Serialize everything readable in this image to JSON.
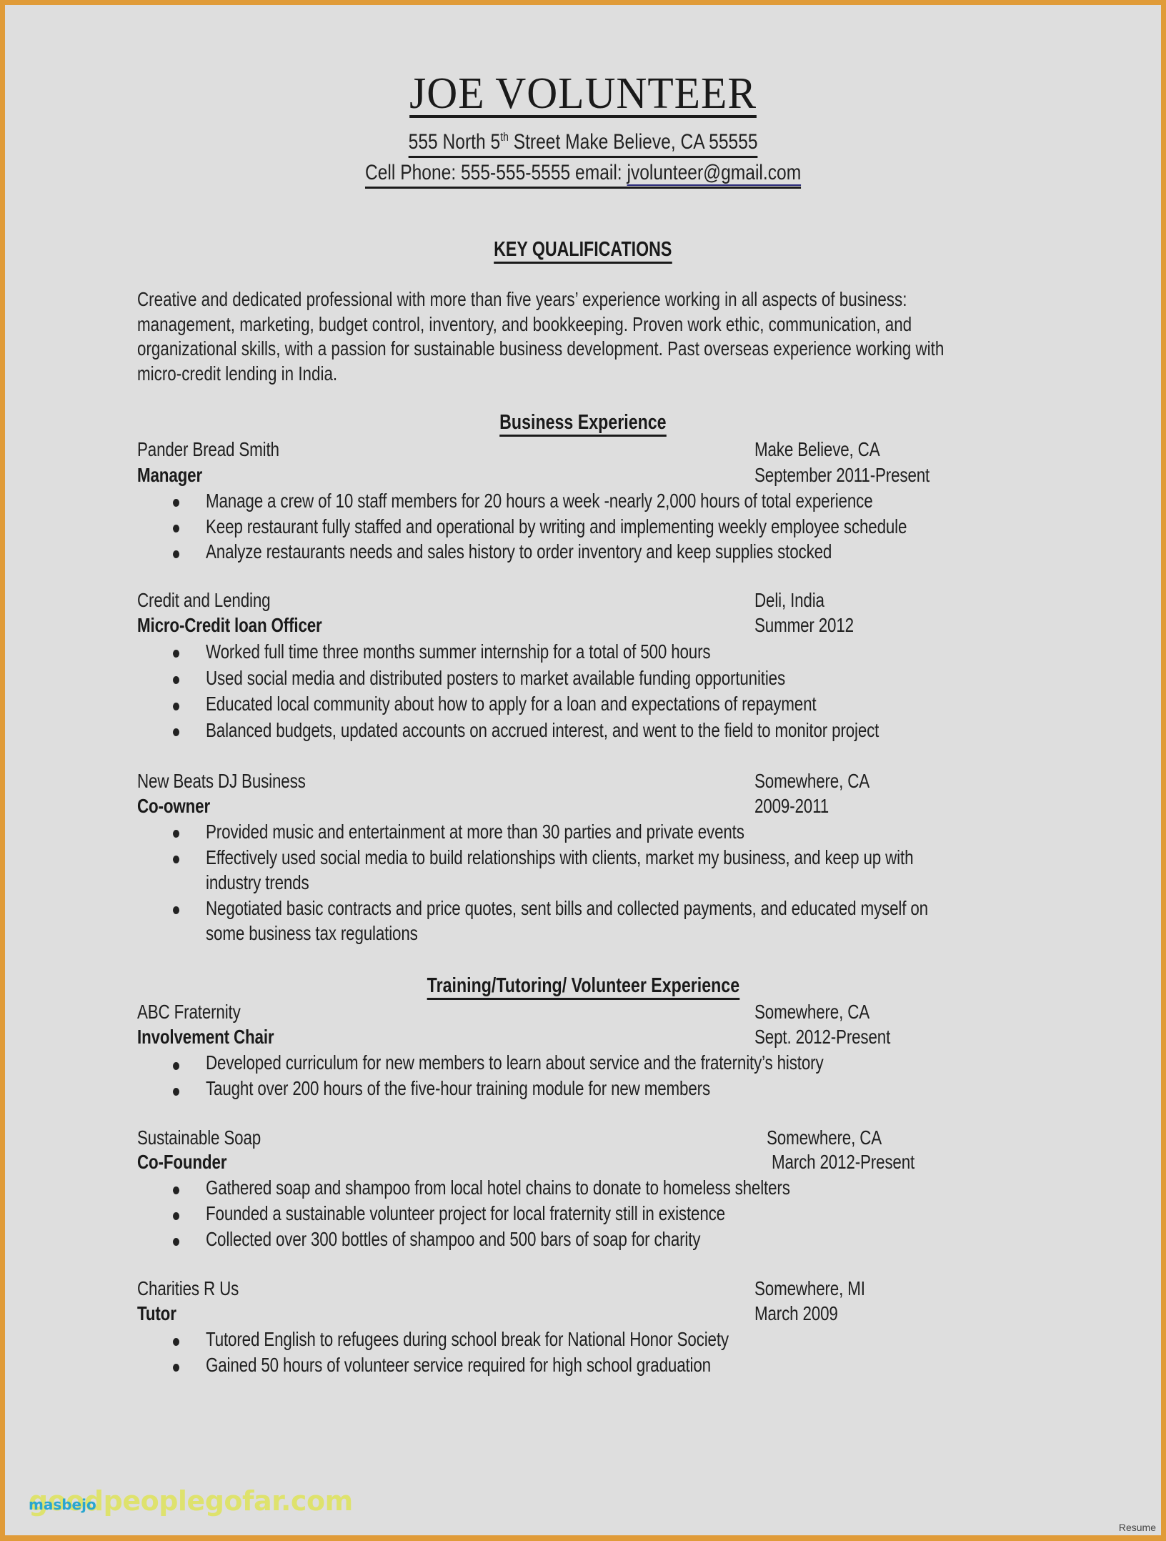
{
  "header": {
    "name": "JOE VOLUNTEER",
    "address_pre": "555 North 5",
    "address_sup": "th",
    "address_post": " Street Make Believe, CA 55555",
    "phone_label": "Cell Phone: 555-555-5555 email: ",
    "email": "jvolunteer@gmail.com"
  },
  "qualifications": {
    "heading": "KEY QUALIFICATIONS",
    "lines": [
      "Creative and dedicated professional with more than five years’ experience working in all aspects of business:",
      "management, marketing, budget control, inventory, and bookkeeping. Proven work ethic, communication, and",
      "organizational skills, with a passion for sustainable business development. Past overseas experience working with",
      "micro-credit lending in India."
    ]
  },
  "business": {
    "heading": "Business Experience",
    "jobs": [
      {
        "org": "Pander Bread Smith",
        "location": "Make Believe, CA",
        "title": "Manager",
        "dates": "September 2011-Present",
        "bullets": [
          "Manage a crew of 10 staff members for 20 hours a week -nearly 2,000 hours of total experience",
          "Keep restaurant fully staffed and operational by writing and implementing weekly employee schedule",
          "Analyze restaurants needs and sales history to order inventory and keep supplies stocked"
        ]
      },
      {
        "org": "Credit and Lending",
        "location": "Deli, India",
        "title": "Micro-Credit loan Officer",
        "dates": "Summer 2012",
        "bullets": [
          "Worked full time three months summer internship for a total of 500 hours",
          "Used social media and distributed posters to market available funding opportunities",
          "Educated local community about how to apply for a loan and expectations of repayment",
          "Balanced budgets, updated accounts on accrued interest, and went to the field to monitor project"
        ]
      },
      {
        "org": "New Beats DJ Business",
        "location": "Somewhere, CA",
        "title": "Co-owner",
        "dates": "2009-2011",
        "bullets": [
          "Provided music and entertainment at more than 30 parties and private events",
          "Effectively used social media to build relationships with clients, market my business, and keep up with",
          "industry trends",
          "Negotiated basic contracts and price quotes, sent bills and collected payments, and educated myself on",
          "some business tax regulations"
        ]
      }
    ]
  },
  "volunteer": {
    "heading": "Training/Tutoring/ Volunteer Experience",
    "jobs": [
      {
        "org": "ABC Fraternity",
        "location": "Somewhere, CA",
        "title": "Involvement Chair",
        "dates": "Sept. 2012-Present",
        "bullets": [
          "Developed curriculum for new members to learn about service and the fraternity’s history",
          "Taught over 200 hours of the five-hour training module for new members"
        ]
      },
      {
        "org": "Sustainable Soap",
        "location": "Somewhere, CA",
        "title": "Co-Founder",
        "dates": "March 2012-Present",
        "bullets": [
          "Gathered soap and shampoo from local hotel chains to donate to homeless shelters",
          "Founded a sustainable volunteer project for local fraternity still in existence",
          "Collected over 300 bottles of shampoo and 500 bars of soap for charity"
        ]
      },
      {
        "org": "Charities R Us",
        "location": "Somewhere, MI",
        "title": "Tutor",
        "dates": "March 2009",
        "bullets": [
          "Tutored English to refugees during school break for National Honor Society",
          "Gained 50 hours of volunteer service required for high school graduation"
        ]
      }
    ]
  },
  "watermark": {
    "site": "goodpeoplegofar.com",
    "author": "masbejo"
  },
  "corner_label": "Resume"
}
